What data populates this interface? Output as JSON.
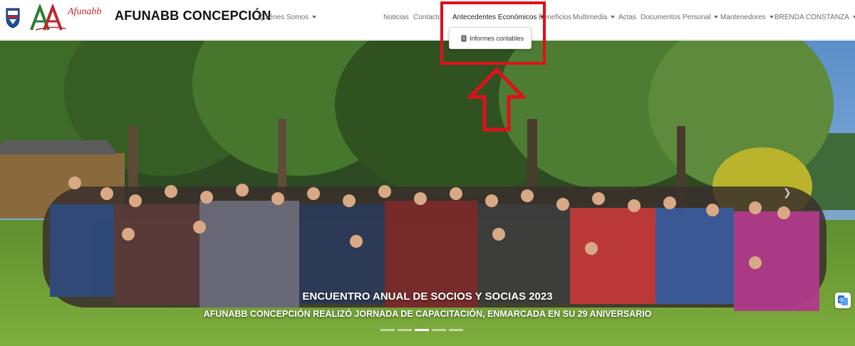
{
  "header": {
    "logo_name": "Afunabb",
    "brand": "AFUNABB CONCEPCIÓN"
  },
  "nav": {
    "quienes_somos": "Quiénes Somos",
    "noticias": "Noticias",
    "contacto": "Contacto",
    "antecedentes": "Antecedentes Económicos",
    "beneficios": "Beneficios",
    "multimedia": "Multimedia",
    "actas": "Actas",
    "documentos": "Documentos",
    "personal": "Personal",
    "mantenedores": "Mantenedores",
    "user": "BRENDA CONSTANZA"
  },
  "dropdown": {
    "items": [
      "Informes contables"
    ]
  },
  "hero": {
    "title": "ENCUENTRO ANUAL DE SOCIOS Y SOCIAS 2023",
    "subtitle": "AFUNABB CONCEPCIÓN REALIZÓ JORNADA DE CAPACITACIÓN, ENMARCADA EN SU 29 ANIVERSARIO",
    "slides_total": 5,
    "active_slide": 3
  },
  "colors": {
    "highlight": "#e0101a",
    "logo_red": "#c0262c",
    "logo_green": "#2e7d32"
  },
  "icons": [
    "crest-icon",
    "afunabb-logo-icon",
    "document-icon",
    "up-arrow-annotation-icon",
    "translate-icon",
    "chevron-right-icon"
  ]
}
